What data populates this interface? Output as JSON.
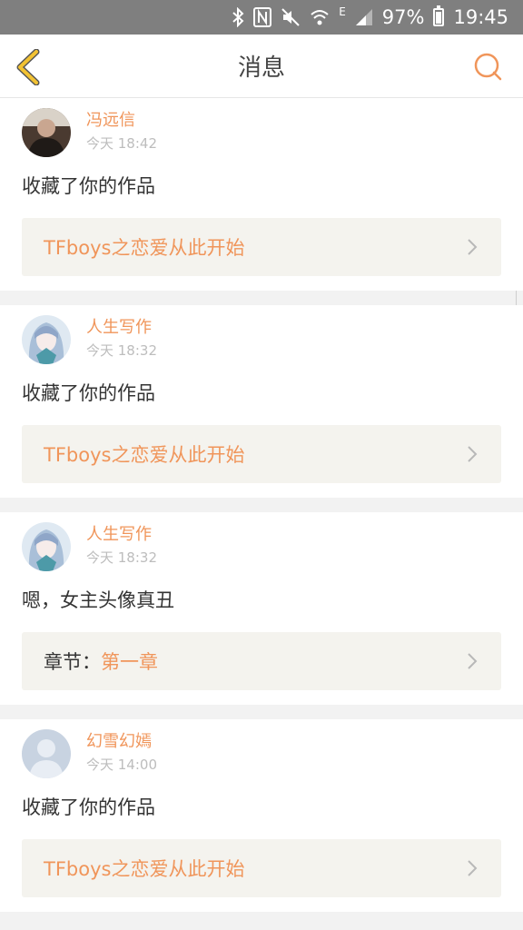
{
  "status_bar": {
    "battery": "97%",
    "time": "19:45",
    "network": "E"
  },
  "header": {
    "title": "消息"
  },
  "messages": [
    {
      "user": "冯远信",
      "time": "今天 18:42",
      "text": "收藏了你的作品",
      "ref": {
        "text": "TFboys之恋爱从此开始"
      }
    },
    {
      "user": "人生写作",
      "time": "今天 18:32",
      "text": "收藏了你的作品",
      "ref": {
        "text": "TFboys之恋爱从此开始"
      }
    },
    {
      "user": "人生写作",
      "time": "今天 18:32",
      "text": "嗯，女主头像真丑",
      "ref": {
        "label": "章节：",
        "text": "第一章"
      }
    },
    {
      "user": "幻雪幻嫣",
      "time": "今天 14:00",
      "text": "收藏了你的作品",
      "ref": {
        "text": "TFboys之恋爱从此开始"
      }
    }
  ],
  "colors": {
    "accent": "#f0955a",
    "back_arrow": "#f2b62a",
    "status_bar": "#7f7f7f"
  }
}
